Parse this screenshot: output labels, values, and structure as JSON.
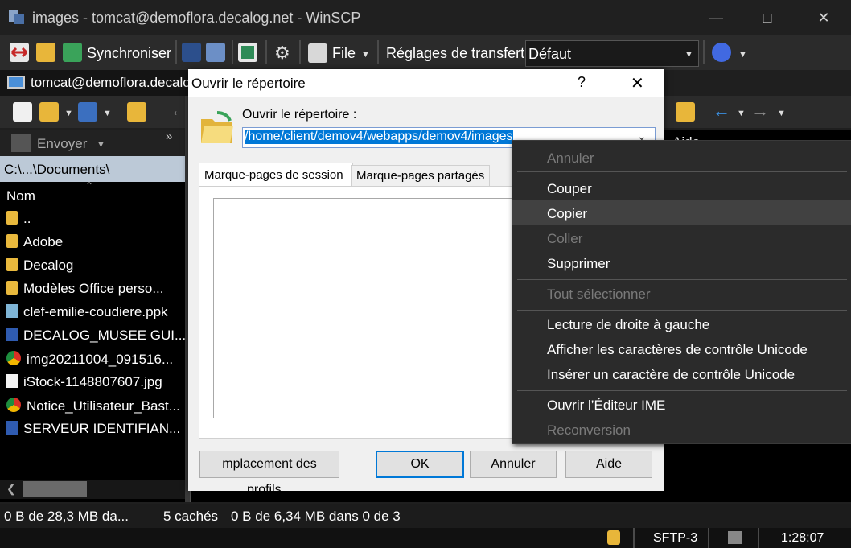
{
  "window": {
    "title": "images - tomcat@demoflora.decalog.net - WinSCP"
  },
  "toolbar": {
    "synchroniser": "Synchroniser",
    "file": "File",
    "transfer_settings_label": "Réglages de transfert",
    "transfer_settings_value": "Défaut"
  },
  "left_panel": {
    "session_tab": "tomcat@demoflora.decalog.net",
    "send_label": "Envoyer",
    "path": "C:\\...\\Documents\\",
    "column_name": "Nom",
    "files": [
      {
        "name": "..",
        "icon": "parent-folder-icon"
      },
      {
        "name": "Adobe",
        "icon": "folder-icon"
      },
      {
        "name": "Decalog",
        "icon": "folder-icon"
      },
      {
        "name": "Modèles Office perso...",
        "icon": "folder-icon"
      },
      {
        "name": "clef-emilie-coudiere.ppk",
        "icon": "key-file-icon"
      },
      {
        "name": "DECALOG_MUSEE GUI...",
        "icon": "word-doc-icon"
      },
      {
        "name": "img20211004_091516...",
        "icon": "chrome-icon"
      },
      {
        "name": "iStock-1148807607.jpg",
        "icon": "image-file-icon"
      },
      {
        "name": "Notice_Utilisateur_Bast...",
        "icon": "chrome-icon"
      },
      {
        "name": "SERVEUR IDENTIFIAN...",
        "icon": "word-doc-icon"
      }
    ]
  },
  "right_panel": {
    "help_label": "Aide"
  },
  "status": {
    "left": "0 B de 28,3 MB da...",
    "hidden": "5 cachés",
    "right": "0 B de 6,34 MB dans 0 de 3",
    "protocol": "SFTP-3",
    "time": "1:28:07"
  },
  "dialog": {
    "title": "Ouvrir le répertoire",
    "help_glyph": "?",
    "field_label": "Ouvrir le répertoire :",
    "path_value": "/home/client/demov4/webapps/demov4/images",
    "tab_session": "Marque-pages de session",
    "tab_shared": "Marque-pages partagés",
    "profiles_button": "mplacement des profils...",
    "ok": "OK",
    "cancel": "Annuler",
    "help": "Aide"
  },
  "context_menu": {
    "undo": "Annuler",
    "cut": "Couper",
    "copy": "Copier",
    "paste": "Coller",
    "delete": "Supprimer",
    "select_all": "Tout sélectionner",
    "rtl": "Lecture de droite à gauche",
    "show_unicode": "Afficher les caractères de contrôle Unicode",
    "insert_unicode": "Insérer un caractère de contrôle Unicode",
    "ime": "Ouvrir l’Éditeur IME",
    "reconversion": "Reconversion"
  }
}
